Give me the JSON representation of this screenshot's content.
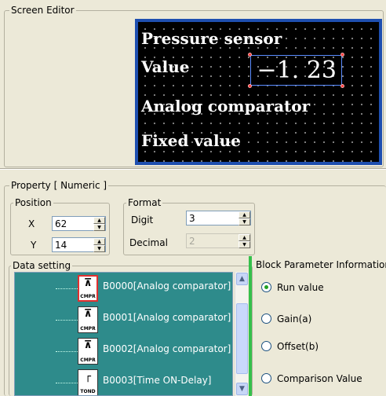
{
  "screen_editor": {
    "title": "Screen Editor",
    "lcd_lines": [
      "Pressure sensor",
      "Value",
      "Analog comparator",
      "Fixed value"
    ],
    "numeric_value": "−1. 23",
    "frame_color": "#1e4fb0"
  },
  "property": {
    "title": "Property [ Numeric ]",
    "position": {
      "title": "Position",
      "x_label": "X",
      "x_value": "62",
      "y_label": "Y",
      "y_value": "14"
    },
    "format": {
      "title": "Format",
      "digit_label": "Digit",
      "digit_value": "3",
      "decimal_label": "Decimal",
      "decimal_value": "2"
    }
  },
  "data_setting": {
    "title": "Data setting",
    "items": [
      {
        "label": "B0000[Analog comparator]",
        "icon": "analog-comparator-icon",
        "tag": "CMPR",
        "selected": true
      },
      {
        "label": "B0001[Analog comparator]",
        "icon": "analog-comparator-icon",
        "tag": "CMPR",
        "selected": false
      },
      {
        "label": "B0002[Analog comparator]",
        "icon": "analog-comparator-icon",
        "tag": "CMPR",
        "selected": false
      },
      {
        "label": "B0003[Time ON-Delay]",
        "icon": "time-on-delay-icon",
        "tag": "TOND",
        "selected": false
      }
    ]
  },
  "block_parameter": {
    "title": "Block Parameter Information",
    "options": [
      {
        "label": "Run value",
        "checked": true
      },
      {
        "label": "Gain(a)",
        "checked": false
      },
      {
        "label": "Offset(b)",
        "checked": false
      },
      {
        "label": "Comparison Value",
        "checked": false
      }
    ]
  },
  "colors": {
    "tree_background": "#2e8b8b",
    "lcd_background": "#000000",
    "accent_bar": "#35c04b"
  }
}
